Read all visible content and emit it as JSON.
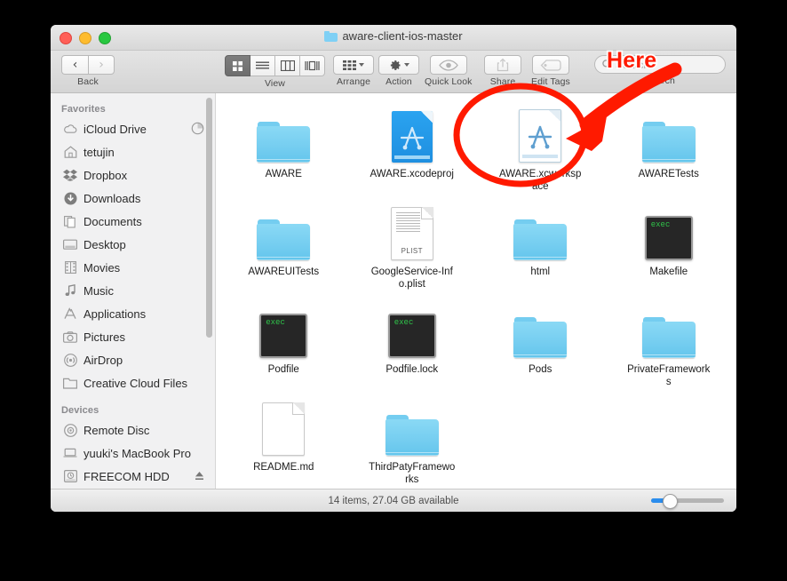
{
  "window": {
    "title": "aware-client-ios-master",
    "traffic_lights": [
      "close",
      "minimize",
      "zoom"
    ]
  },
  "toolbar": {
    "back_label": "Back",
    "view_label": "View",
    "arrange_label": "Arrange",
    "action_label": "Action",
    "quicklook_label": "Quick Look",
    "share_label": "Share",
    "tags_label": "Edit Tags",
    "search_label": "Search",
    "view_modes": [
      "icon-view",
      "list-view",
      "column-view",
      "coverflow-view"
    ],
    "view_active_index": 0
  },
  "search": {
    "placeholder": "Search",
    "value": ""
  },
  "sidebar": {
    "sections": [
      {
        "header": "Favorites",
        "items": [
          {
            "label": "iCloud Drive",
            "icon": "cloud-icon",
            "accessory": "progress-icon"
          },
          {
            "label": "tetujin",
            "icon": "home-icon",
            "accessory": ""
          },
          {
            "label": "Dropbox",
            "icon": "dropbox-icon",
            "accessory": ""
          },
          {
            "label": "Downloads",
            "icon": "download-icon",
            "accessory": ""
          },
          {
            "label": "Documents",
            "icon": "documents-icon",
            "accessory": ""
          },
          {
            "label": "Desktop",
            "icon": "desktop-icon",
            "accessory": ""
          },
          {
            "label": "Movies",
            "icon": "movies-icon",
            "accessory": ""
          },
          {
            "label": "Music",
            "icon": "music-icon",
            "accessory": ""
          },
          {
            "label": "Applications",
            "icon": "applications-icon",
            "accessory": ""
          },
          {
            "label": "Pictures",
            "icon": "pictures-icon",
            "accessory": ""
          },
          {
            "label": "AirDrop",
            "icon": "airdrop-icon",
            "accessory": ""
          },
          {
            "label": "Creative Cloud Files",
            "icon": "folder-icon",
            "accessory": ""
          }
        ]
      },
      {
        "header": "Devices",
        "items": [
          {
            "label": "Remote Disc",
            "icon": "disc-icon",
            "accessory": ""
          },
          {
            "label": "yuuki's MacBook Pro",
            "icon": "laptop-icon",
            "accessory": ""
          },
          {
            "label": "FREECOM HDD",
            "icon": "harddisk-icon",
            "accessory": "eject-icon"
          }
        ]
      }
    ]
  },
  "files": [
    {
      "name": "AWARE",
      "icon": "folder-icon"
    },
    {
      "name": "AWARE.xcodeproj",
      "icon": "xcodeproj-icon"
    },
    {
      "name": "AWARE.xcworkspace",
      "icon": "xcworkspace-icon"
    },
    {
      "name": "AWARETests",
      "icon": "folder-icon"
    },
    {
      "name": "AWAREUITests",
      "icon": "folder-icon"
    },
    {
      "name": "GoogleService-Info.plist",
      "icon": "plist-icon",
      "badge": "PLIST"
    },
    {
      "name": "html",
      "icon": "folder-icon"
    },
    {
      "name": "Makefile",
      "icon": "exec-icon",
      "badge": "exec"
    },
    {
      "name": "Podfile",
      "icon": "exec-icon",
      "badge": "exec"
    },
    {
      "name": "Podfile.lock",
      "icon": "exec-icon",
      "badge": "exec"
    },
    {
      "name": "Pods",
      "icon": "folder-icon"
    },
    {
      "name": "PrivateFrameworks",
      "icon": "folder-icon"
    },
    {
      "name": "README.md",
      "icon": "document-icon"
    },
    {
      "name": "ThirdPatyFrameworks",
      "icon": "folder-icon"
    }
  ],
  "statusbar": {
    "text": "14 items, 27.04 GB available",
    "zoom_slider_value": 18
  },
  "annotation": {
    "label": "Here",
    "color": "#ff1a00",
    "target": "AWARE.xcworkspace"
  }
}
